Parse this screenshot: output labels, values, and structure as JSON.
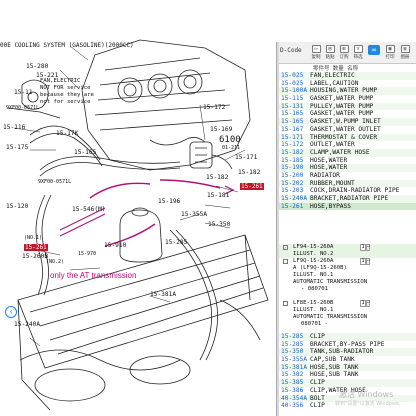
{
  "diagram": {
    "title": "00E  COOLING SYSTEM (GASOLINE)(2000CC)",
    "note_lines": [
      "FAN,ELECTRIC",
      "NOT FOR service",
      "because they are",
      "not for service"
    ],
    "caption": "only the AT transmission",
    "labels": [
      {
        "t": "15-280"
      },
      {
        "t": "15-221"
      },
      {
        "t": "15-11"
      },
      {
        "t": "9XF00-0571L"
      },
      {
        "t": "15-116"
      },
      {
        "t": "15-17K"
      },
      {
        "t": "15-165"
      },
      {
        "t": "15-175"
      },
      {
        "t": "9XF00-0571L"
      },
      {
        "t": "15-120"
      },
      {
        "t": "15-546(M)"
      },
      {
        "t": "15-196"
      },
      {
        "t": "15-172"
      },
      {
        "t": "15-169"
      },
      {
        "t": "6100",
        "big": true
      },
      {
        "t": "01-211"
      },
      {
        "t": "15-182"
      },
      {
        "t": "15-182"
      },
      {
        "t": "15-181"
      },
      {
        "t": "15-355A"
      },
      {
        "t": "15-350"
      },
      {
        "t": "15-285"
      },
      {
        "t": "15-350"
      },
      {
        "t": "15-910"
      },
      {
        "t": "15-970"
      },
      {
        "t": "(NO.1)"
      },
      {
        "t": "15-260B"
      },
      {
        "t": "(NO.2)"
      },
      {
        "t": "15-381A"
      },
      {
        "t": "15-240A"
      },
      {
        "t": "15-171"
      }
    ],
    "red_tags": [
      "15-261",
      "15-261"
    ]
  },
  "toolbar": {
    "dcode_label": "D-Code",
    "buttons": [
      {
        "icon": "copy",
        "label": "复制"
      },
      {
        "icon": "paste",
        "label": "粘贴"
      },
      {
        "icon": "cart",
        "label": "订购"
      },
      {
        "icon": "filter",
        "label": "筛选"
      },
      {
        "icon": "print",
        "label": "打印"
      },
      {
        "icon": "book",
        "label": "图册"
      }
    ],
    "columns": "零件号  数量 名称"
  },
  "parts": [
    {
      "code": "15-025",
      "desc": "FAN,ELECTRIC"
    },
    {
      "code": "15-025",
      "desc": "LABEL,CAUTION"
    },
    {
      "code": "15-100A",
      "desc": "HOUSING,WATER PUMP"
    },
    {
      "code": "15-115",
      "desc": "GASKET,WATER PUMP"
    },
    {
      "code": "15-131",
      "desc": "PULLEY,WATER PUMP"
    },
    {
      "code": "15-165",
      "desc": "GASKET,WATER PUMP"
    },
    {
      "code": "15-165",
      "desc": "GASKET,W.PUMP INLET"
    },
    {
      "code": "15-167",
      "desc": "GASKET,WATER OUTLET"
    },
    {
      "code": "15-171",
      "desc": "THERMOSTAT & COVER"
    },
    {
      "code": "15-172",
      "desc": "OUTLET,WATER"
    },
    {
      "code": "15-182",
      "desc": "CLAMP,WATER HOSE"
    },
    {
      "code": "15-185",
      "desc": "HOSE,WATER"
    },
    {
      "code": "15-190",
      "desc": "HOSE,WATER"
    },
    {
      "code": "15-200",
      "desc": "RADIATOR"
    },
    {
      "code": "15-202",
      "desc": "RUBBER,MOUNT"
    },
    {
      "code": "15-203",
      "desc": "COCK,DRAIN-RADIATOR PIPE"
    },
    {
      "code": "15-240A",
      "desc": "BRACKET,RADIATOR PIPE"
    },
    {
      "code": "15-261",
      "desc": "HOSE,BYPASS"
    }
  ],
  "detail": [
    {
      "text": "LF94-15-260A",
      "qty": "1",
      "green": true,
      "check": true
    },
    {
      "text": "ILLUST. NO.2",
      "green": true
    },
    {
      "text": "LF9Q-15-260A",
      "qty": "1",
      "check": true
    },
    {
      "text": "A (LF9Q-15-260B)"
    },
    {
      "text": "ILLUST. NO.1"
    },
    {
      "text": "AUTOMATIC TRANSMISSION"
    },
    {
      "text": "- 080701"
    },
    {
      "text": ""
    },
    {
      "text": "LF8E-15-260B",
      "qty": "1",
      "check": true
    },
    {
      "text": "ILLUST. NO.1"
    },
    {
      "text": "AUTOMATIC TRANSMISSION"
    },
    {
      "text": "080701 -"
    }
  ],
  "parts2": [
    {
      "code": "15-285",
      "desc": "CLIP"
    },
    {
      "code": "15-285",
      "desc": "BRACKET,BY-PASS PIPE"
    },
    {
      "code": "15-350",
      "desc": "TANK,SUB-RADIATOR"
    },
    {
      "code": "15-355A",
      "desc": "CAP,SUB TANK"
    },
    {
      "code": "15-381A",
      "desc": "HOSE,SUB TANK"
    },
    {
      "code": "15-382",
      "desc": "HOSE,SUB TANK"
    },
    {
      "code": "15-385",
      "desc": "CLIP"
    },
    {
      "code": "15-386",
      "desc": "CLIP,WATER HOSE"
    },
    {
      "code": "40-354A",
      "desc": "BOLT"
    },
    {
      "code": "40-356",
      "desc": "CLIP"
    }
  ],
  "watermark": "激活 Windows",
  "watermark_sub": "转到\"设置\"以激活 Windows。"
}
